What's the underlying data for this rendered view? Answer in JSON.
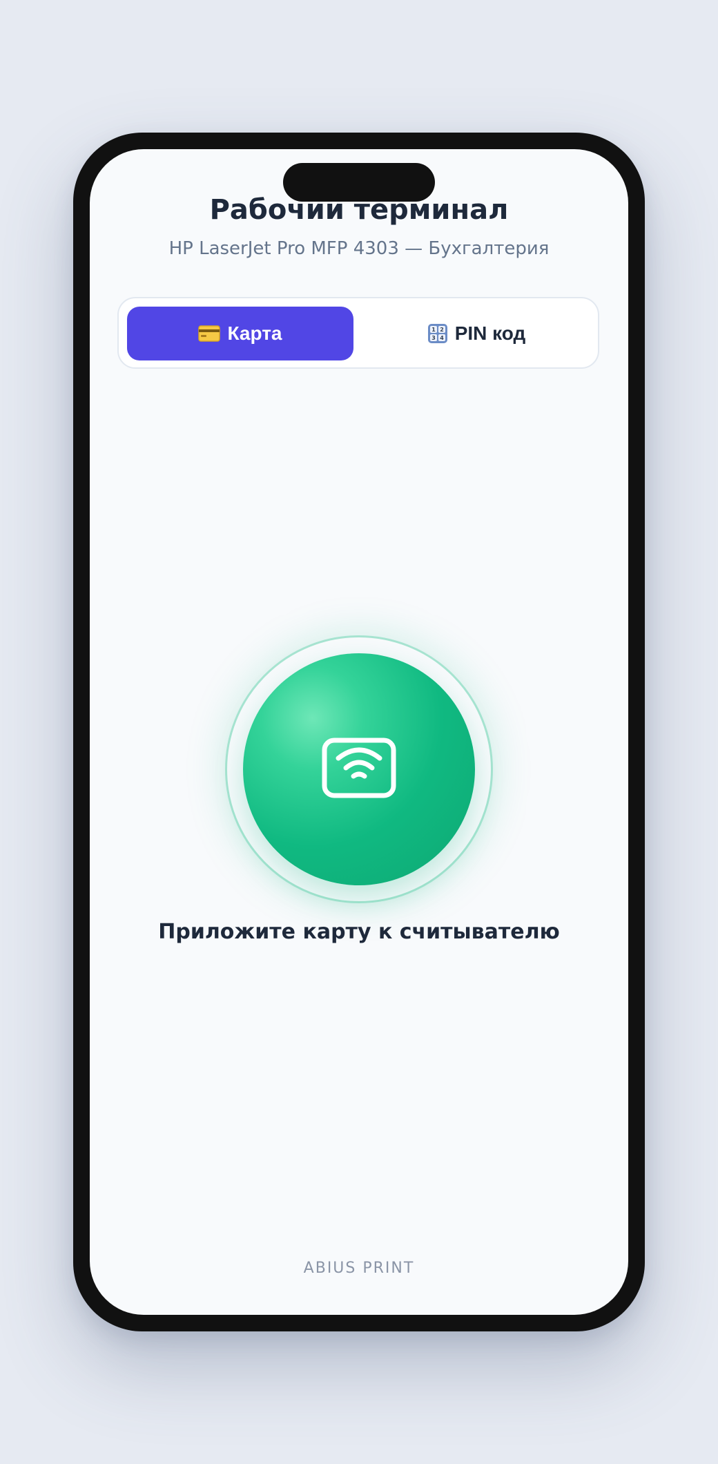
{
  "header": {
    "title": "Рабочий терминал",
    "subtitle": "HP LaserJet Pro MFP 4303 — Бухгалтерия"
  },
  "tabs": [
    {
      "label": "Карта",
      "icon": "credit-card-icon",
      "active": true
    },
    {
      "label": "PIN код",
      "icon": "keypad-numbers-icon",
      "active": false
    }
  ],
  "reader": {
    "icon": "nfc-card-reader-icon",
    "instruction": "Приложите карту к считывателю"
  },
  "footer": {
    "brand": "ABIUS PRINT"
  },
  "colors": {
    "accent": "#5146e5",
    "reader": "#10b981",
    "text_primary": "#1e293b",
    "text_secondary": "#64748b",
    "background": "#f8fafc"
  }
}
